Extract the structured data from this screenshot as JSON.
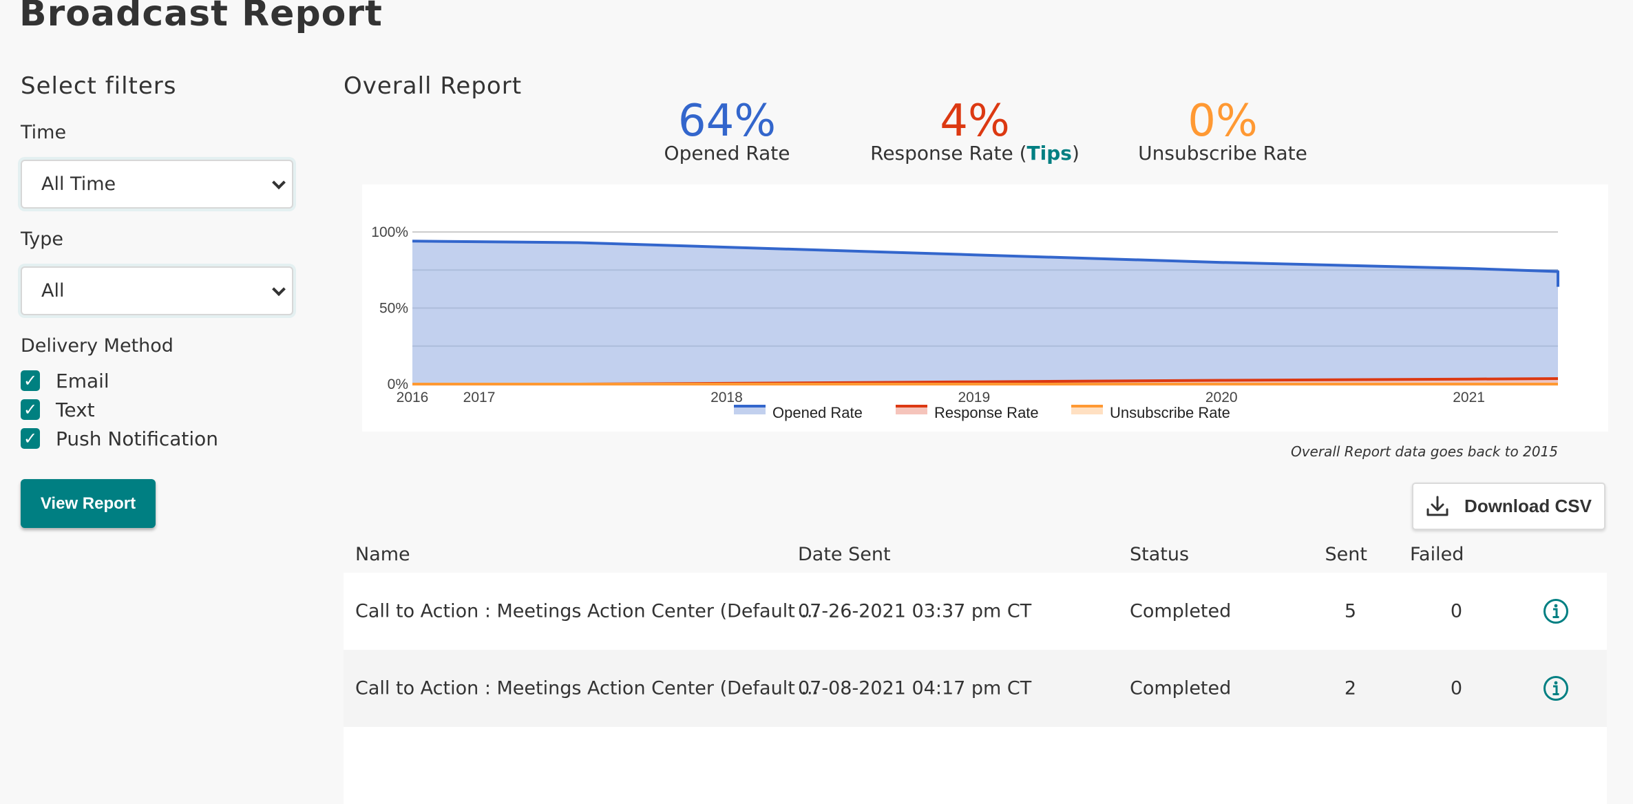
{
  "page": {
    "title": "Broadcast Report"
  },
  "filters": {
    "heading": "Select filters",
    "time": {
      "label": "Time",
      "value": "All Time"
    },
    "type": {
      "label": "Type",
      "value": "All"
    },
    "delivery": {
      "label": "Delivery Method",
      "options": [
        {
          "label": "Email",
          "checked": true
        },
        {
          "label": "Text",
          "checked": true
        },
        {
          "label": "Push Notification",
          "checked": true
        }
      ]
    },
    "view_report_label": "View Report"
  },
  "overall": {
    "heading": "Overall Report",
    "stats": [
      {
        "value": "64%",
        "label": "Opened Rate",
        "color": "#3366cc"
      },
      {
        "value": "4%",
        "label": "Response Rate",
        "link": "Tips",
        "color": "#dc3912"
      },
      {
        "value": "0%",
        "label": "Unsubscribe Rate",
        "color": "#ff9933"
      }
    ],
    "note": "Overall Report data goes back to 2015",
    "download_label": "Download CSV",
    "accent_color": "#007f82"
  },
  "chart_data": {
    "type": "area",
    "title": "",
    "xlabel": "",
    "ylabel": "",
    "x_ticks": [
      "2016",
      "2017",
      "2018",
      "2019",
      "2020",
      "2021"
    ],
    "x_tick_values": [
      2016.73,
      2017.0,
      2018.0,
      2019.0,
      2020.0,
      2021.0
    ],
    "xlim": [
      2016.73,
      2021.36
    ],
    "y_ticks": [
      "0%",
      "50%",
      "100%"
    ],
    "ylim": [
      0,
      100
    ],
    "grid": true,
    "legend_position": "bottom",
    "x": [
      2016.73,
      2017.4,
      2018.0,
      2019.0,
      2020.0,
      2021.0,
      2021.36,
      2021.36
    ],
    "series": [
      {
        "name": "Opened Rate",
        "color": "#3366cc",
        "fill": "#c2d0ee",
        "values": [
          94,
          93,
          90,
          85,
          80,
          76,
          74,
          64
        ]
      },
      {
        "name": "Response Rate",
        "color": "#dc3912",
        "fill": "#f5c4bb",
        "values": [
          0,
          0,
          0.5,
          1.5,
          2.5,
          3.3,
          3.6,
          3.6
        ]
      },
      {
        "name": "Unsubscribe Rate",
        "color": "#ff9933",
        "fill": "#ffe0c2",
        "values": [
          0,
          0,
          0,
          0,
          0,
          0,
          0,
          0
        ]
      }
    ]
  },
  "table": {
    "columns": [
      "Name",
      "Date Sent",
      "Status",
      "Sent",
      "Failed"
    ],
    "rows": [
      {
        "name": "Call to Action : Meetings Action Center (Default ...",
        "date_sent": "07-26-2021 03:37 pm CT",
        "status": "Completed",
        "sent": "5",
        "failed": "0"
      },
      {
        "name": "Call to Action : Meetings Action Center (Default ...",
        "date_sent": "07-08-2021 04:17 pm CT",
        "status": "Completed",
        "sent": "2",
        "failed": "0"
      }
    ]
  }
}
